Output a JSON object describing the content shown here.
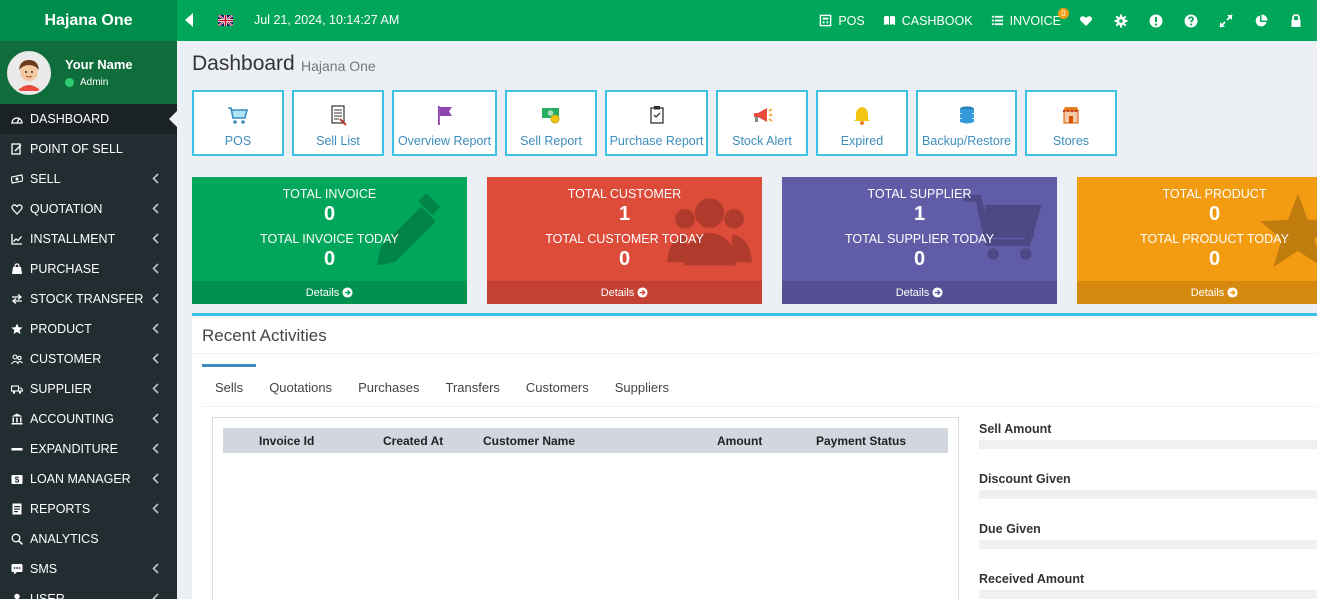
{
  "brand": "Hajana One",
  "user": {
    "name": "Your Name",
    "role": "Admin"
  },
  "sidebar": {
    "items": [
      {
        "label": "DASHBOARD",
        "icon": "dashboard-icon",
        "chevron": false,
        "active": true
      },
      {
        "label": "POINT OF SELL",
        "icon": "edit-icon",
        "chevron": false
      },
      {
        "label": "SELL",
        "icon": "money-icon",
        "chevron": true
      },
      {
        "label": "QUOTATION",
        "icon": "heart-icon",
        "chevron": true
      },
      {
        "label": "INSTALLMENT",
        "icon": "chart-icon",
        "chevron": true
      },
      {
        "label": "PURCHASE",
        "icon": "bag-icon",
        "chevron": true
      },
      {
        "label": "STOCK TRANSFER",
        "icon": "transfer-icon",
        "chevron": true
      },
      {
        "label": "PRODUCT",
        "icon": "star-icon",
        "chevron": true
      },
      {
        "label": "CUSTOMER",
        "icon": "users-icon",
        "chevron": true
      },
      {
        "label": "SUPPLIER",
        "icon": "truck-icon",
        "chevron": true
      },
      {
        "label": "ACCOUNTING",
        "icon": "bank-icon",
        "chevron": true
      },
      {
        "label": "EXPANDITURE",
        "icon": "minus-icon",
        "chevron": true
      },
      {
        "label": "LOAN MANAGER",
        "icon": "dollar-icon",
        "chevron": true
      },
      {
        "label": "REPORTS",
        "icon": "report-icon",
        "chevron": true
      },
      {
        "label": "ANALYTICS",
        "icon": "search-icon",
        "chevron": false
      },
      {
        "label": "SMS",
        "icon": "sms-icon",
        "chevron": true
      },
      {
        "label": "USER",
        "icon": "user-icon",
        "chevron": true
      }
    ]
  },
  "header": {
    "datetime": "Jul 21, 2024, 10:14:27 AM",
    "pos_label": "POS",
    "cashbook_label": "CASHBOOK",
    "invoice_label": "INVOICE",
    "invoice_badge": "0"
  },
  "page": {
    "title": "Dashboard",
    "subtitle": "Hajana One"
  },
  "quick_buttons": [
    {
      "label": "POS",
      "icon": "cart-icon"
    },
    {
      "label": "Sell List",
      "icon": "list-icon"
    },
    {
      "label": "Overview Report",
      "icon": "flag-icon"
    },
    {
      "label": "Sell Report",
      "icon": "cash-icon"
    },
    {
      "label": "Purchase Report",
      "icon": "clipboard-icon"
    },
    {
      "label": "Stock Alert",
      "icon": "megaphone-icon"
    },
    {
      "label": "Expired",
      "icon": "bell-icon"
    },
    {
      "label": "Backup/Restore",
      "icon": "database-icon"
    },
    {
      "label": "Stores",
      "icon": "store-icon"
    }
  ],
  "stats": [
    {
      "label": "TOTAL INVOICE",
      "value": "0",
      "label_today": "TOTAL INVOICE TODAY",
      "value_today": "0",
      "details": "Details",
      "color": "#00a65a"
    },
    {
      "label": "TOTAL CUSTOMER",
      "value": "1",
      "label_today": "TOTAL CUSTOMER TODAY",
      "value_today": "0",
      "details": "Details",
      "color": "#dd4b39"
    },
    {
      "label": "TOTAL SUPPLIER",
      "value": "1",
      "label_today": "TOTAL SUPPLIER TODAY",
      "value_today": "0",
      "details": "Details",
      "color": "#605ca8"
    },
    {
      "label": "TOTAL PRODUCT",
      "value": "0",
      "label_today": "TOTAL PRODUCT TODAY",
      "value_today": "0",
      "details": "Details",
      "color": "#f39c12"
    }
  ],
  "recent": {
    "title": "Recent Activities",
    "tabs": [
      "Sells",
      "Quotations",
      "Purchases",
      "Transfers",
      "Customers",
      "Suppliers"
    ],
    "columns": [
      "Invoice Id",
      "Created At",
      "Customer Name",
      "Amount",
      "Payment Status"
    ],
    "summary": [
      "Sell Amount",
      "Discount Given",
      "Due Given",
      "Received Amount"
    ]
  }
}
